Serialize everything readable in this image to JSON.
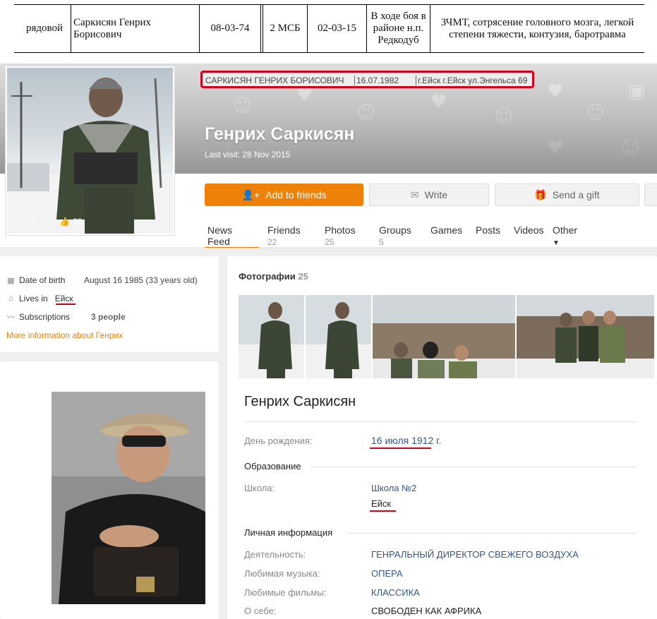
{
  "record": {
    "rank": "рядовой",
    "name_line1": "Саркисян Генрих",
    "name_line2": "Борисович",
    "birth_date": "08-03-74",
    "unit": "2 МСБ",
    "date": "02-03-15",
    "place_line1": "В ходе боя в",
    "place_line2": "районе н.п.",
    "place_line3": "Редкодуб",
    "injury_line1": "ЗЧМТ, сотрясение головного мозга, легкой",
    "injury_line2": "степени тяжести, контузия, баротравма"
  },
  "highlight": {
    "full_name": "САРКИСЯН ГЕНРИХ БОРИСОВИЧ",
    "dob": "16.07.1982",
    "address": "г.Ейск г.Ейск ул.Энгельса 69"
  },
  "profile": {
    "name": "Генрих Саркисян",
    "last_visit": "Last visit: 28 Nov 2015",
    "avatar_count_a": "12",
    "avatar_likes": "28"
  },
  "actions": {
    "add_friends": "Add to friends",
    "write": "Write",
    "gift": "Send a gift"
  },
  "tabs": [
    {
      "label": "News Feed",
      "count": ""
    },
    {
      "label": "Friends",
      "count": "22"
    },
    {
      "label": "Photos",
      "count": "25"
    },
    {
      "label": "Groups",
      "count": "5"
    },
    {
      "label": "Games",
      "count": ""
    },
    {
      "label": "Posts",
      "count": ""
    },
    {
      "label": "Videos",
      "count": ""
    },
    {
      "label": "Other",
      "count": ""
    }
  ],
  "about": {
    "dob_label": "Date of birth",
    "dob_value": "August 16 1985 (33 years old)",
    "lives_label": "Lives in",
    "lives_value": "Ейск",
    "subs_label": "Subscriptions",
    "subs_value": "3 people",
    "more_link": "More information about Генрих"
  },
  "photos": {
    "title": "Фотографии",
    "count": "25"
  },
  "vk": {
    "name": "Генрих Саркисян",
    "birthday_label": "День рождения:",
    "birthday_value": "16 июля 1912 г.",
    "education_header": "Образование",
    "school_label": "Школа:",
    "school_value": "Школа №2",
    "school_city": "Ейск",
    "personal_header": "Личная информация",
    "activity_label": "Деятельность:",
    "activity_value": "ГЕНРАЛЬНЫЙ ДИРЕКТОР СВЕЖЕГО ВОЗДУХА",
    "music_label": "Любимая музыка:",
    "music_value": "ОПЕРА",
    "films_label": "Любимые фильмы:",
    "films_value": "КЛАССИКА",
    "about_label": "О себе:",
    "about_value": "СВОБОДЕН КАК АФРИКА"
  },
  "colors": {
    "accent": "#ee8208",
    "highlight_red": "#d0021b",
    "link_blue": "#31588a"
  }
}
